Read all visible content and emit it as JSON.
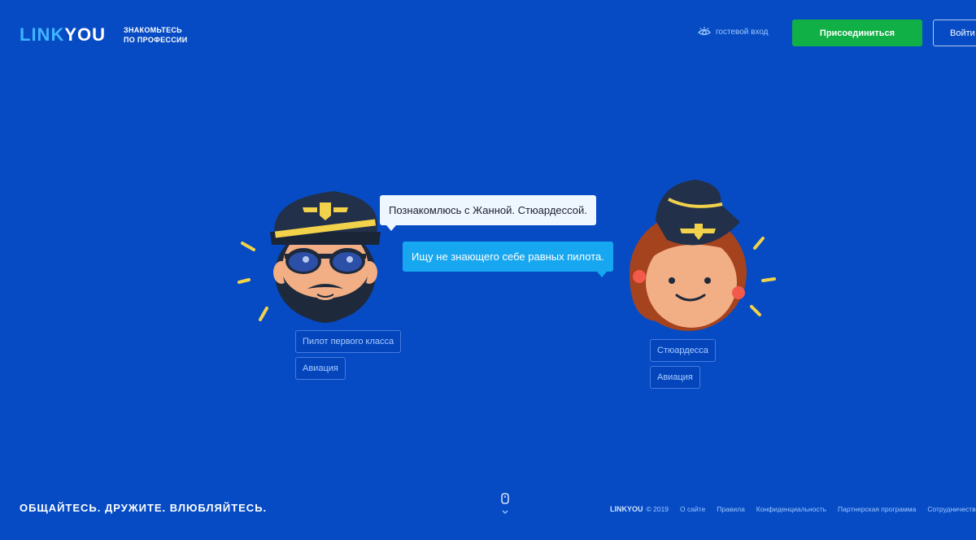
{
  "header": {
    "logo_part1": "LINK",
    "logo_part2": "YOU",
    "tagline_line1": "ЗНАКОМЬТЕСЬ",
    "tagline_line2": "ПО ПРОФЕССИИ",
    "guest_label": "гостевой вход",
    "guest_icon": "eye-icon",
    "join_label": "Присоединиться",
    "login_label": "Войти"
  },
  "chat": {
    "pilot_message": "Познакомлюсь с Жанной. Стюардессой.",
    "stewardess_message": "Ищу не знающего себе равных пилота."
  },
  "pilot": {
    "tags": [
      "Пилот первого класса",
      "Авиация"
    ]
  },
  "stewardess": {
    "tags": [
      "Стюардесса",
      "Авиация"
    ]
  },
  "footer": {
    "slogan": "ОБЩАЙТЕСЬ. ДРУЖИТЕ. ВЛЮБЛЯЙТЕСЬ.",
    "brand": "LINKYOU",
    "copyright": "© 2019",
    "links": [
      "О сайте",
      "Правила",
      "Конфиденциальность",
      "Партнерская программа",
      "Сотрудничество"
    ]
  },
  "colors": {
    "background": "#064bc4",
    "join_button": "#11b046",
    "accent_light_blue": "#17a7f0",
    "logo_link": "#3fb5ff"
  }
}
